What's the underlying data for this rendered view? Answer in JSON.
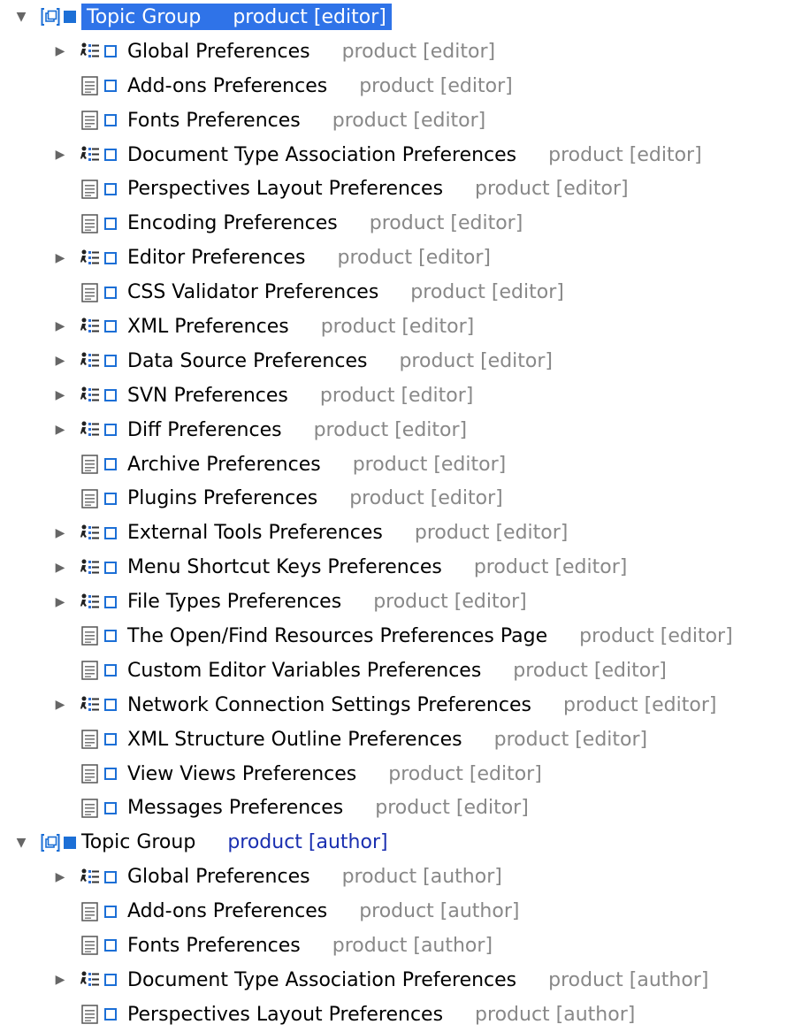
{
  "tree": {
    "groups": [
      {
        "label": "Topic Group",
        "tag": "product [editor]",
        "expanded": true,
        "selected": true,
        "children": [
          {
            "label": "Global Preferences",
            "tag": "product [editor]",
            "type": "topic",
            "expandable": true
          },
          {
            "label": "Add-ons Preferences",
            "tag": "product [editor]",
            "type": "page",
            "expandable": false
          },
          {
            "label": "Fonts Preferences",
            "tag": "product [editor]",
            "type": "page",
            "expandable": false
          },
          {
            "label": "Document Type Association Preferences",
            "tag": "product [editor]",
            "type": "topic",
            "expandable": true
          },
          {
            "label": "Perspectives Layout Preferences",
            "tag": "product [editor]",
            "type": "page",
            "expandable": false
          },
          {
            "label": "Encoding Preferences",
            "tag": "product [editor]",
            "type": "page",
            "expandable": false
          },
          {
            "label": "Editor Preferences",
            "tag": "product [editor]",
            "type": "topic",
            "expandable": true
          },
          {
            "label": "CSS Validator Preferences",
            "tag": "product [editor]",
            "type": "page",
            "expandable": false
          },
          {
            "label": "XML Preferences",
            "tag": "product [editor]",
            "type": "topic",
            "expandable": true
          },
          {
            "label": "Data Source Preferences",
            "tag": "product [editor]",
            "type": "topic",
            "expandable": true
          },
          {
            "label": "SVN Preferences",
            "tag": "product [editor]",
            "type": "topic",
            "expandable": true
          },
          {
            "label": "Diff Preferences",
            "tag": "product [editor]",
            "type": "topic",
            "expandable": true
          },
          {
            "label": "Archive Preferences",
            "tag": "product [editor]",
            "type": "page",
            "expandable": false
          },
          {
            "label": "Plugins Preferences",
            "tag": "product [editor]",
            "type": "page",
            "expandable": false
          },
          {
            "label": "External Tools Preferences",
            "tag": "product [editor]",
            "type": "topic",
            "expandable": true
          },
          {
            "label": "Menu Shortcut Keys Preferences",
            "tag": "product [editor]",
            "type": "topic",
            "expandable": true
          },
          {
            "label": "File Types Preferences",
            "tag": "product [editor]",
            "type": "topic",
            "expandable": true
          },
          {
            "label": "The Open/Find Resources Preferences Page",
            "tag": "product [editor]",
            "type": "page",
            "expandable": false
          },
          {
            "label": "Custom Editor Variables Preferences",
            "tag": "product [editor]",
            "type": "page",
            "expandable": false
          },
          {
            "label": "Network Connection Settings Preferences",
            "tag": "product [editor]",
            "type": "topic",
            "expandable": true
          },
          {
            "label": "XML Structure Outline Preferences",
            "tag": "product [editor]",
            "type": "page",
            "expandable": false
          },
          {
            "label": "View Views Preferences",
            "tag": "product [editor]",
            "type": "page",
            "expandable": false
          },
          {
            "label": "Messages Preferences",
            "tag": "product [editor]",
            "type": "page",
            "expandable": false
          }
        ]
      },
      {
        "label": "Topic Group",
        "tag": "product [author]",
        "expanded": true,
        "selected": false,
        "children": [
          {
            "label": "Global Preferences",
            "tag": "product [author]",
            "type": "topic",
            "expandable": true
          },
          {
            "label": "Add-ons Preferences",
            "tag": "product [author]",
            "type": "page",
            "expandable": false
          },
          {
            "label": "Fonts Preferences",
            "tag": "product [author]",
            "type": "page",
            "expandable": false
          },
          {
            "label": "Document Type Association Preferences",
            "tag": "product [author]",
            "type": "topic",
            "expandable": true
          },
          {
            "label": "Perspectives Layout Preferences",
            "tag": "product [author]",
            "type": "page",
            "expandable": false
          }
        ]
      }
    ],
    "icons": {
      "expanded": "triangle-down-icon",
      "collapsed": "triangle-right-icon",
      "topic": "topic-tree-icon",
      "page": "document-page-icon",
      "group": "group-bracket-icon",
      "marker": "square-marker-icon"
    },
    "colors": {
      "selection": "#2f73e8",
      "marker": "#1c6fd6",
      "tag_editor": "#888888",
      "tag_author": "#1a2fb0"
    }
  }
}
